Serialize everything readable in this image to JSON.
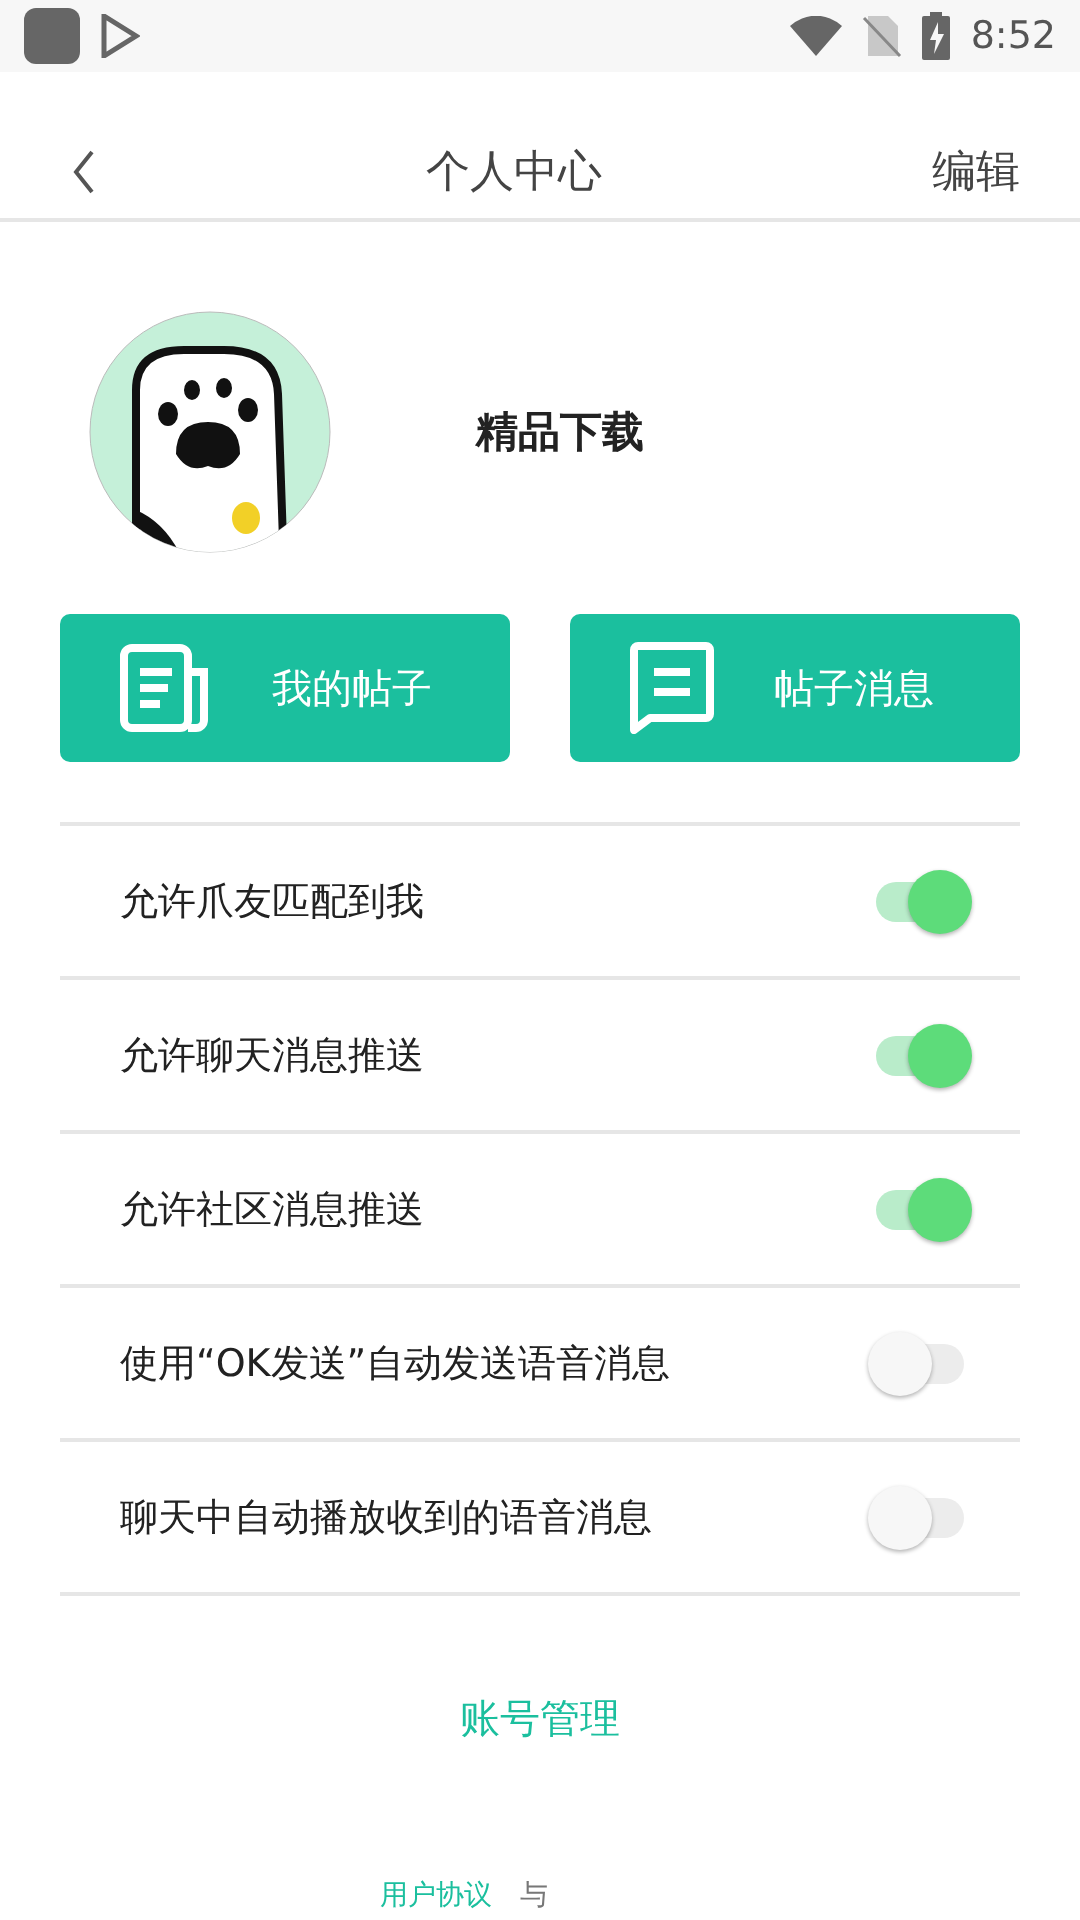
{
  "status_bar": {
    "time": "8:52"
  },
  "header": {
    "title": "个人中心",
    "action": "编辑"
  },
  "profile": {
    "name": "精品下载"
  },
  "buttons": [
    {
      "label": "我的帖子",
      "kind": "posts"
    },
    {
      "label": "帖子消息",
      "kind": "messages"
    }
  ],
  "settings": [
    {
      "label": "允许爪友匹配到我",
      "on": true
    },
    {
      "label": "允许聊天消息推送",
      "on": true
    },
    {
      "label": "允许社区消息推送",
      "on": true
    },
    {
      "label": "使用“OK发送”自动发送语音消息",
      "on": false
    },
    {
      "label": "聊天中自动播放收到的语音消息",
      "on": false
    }
  ],
  "account_link": "账号管理",
  "footer": {
    "links": [
      "用户协议"
    ],
    "separator": "与"
  }
}
